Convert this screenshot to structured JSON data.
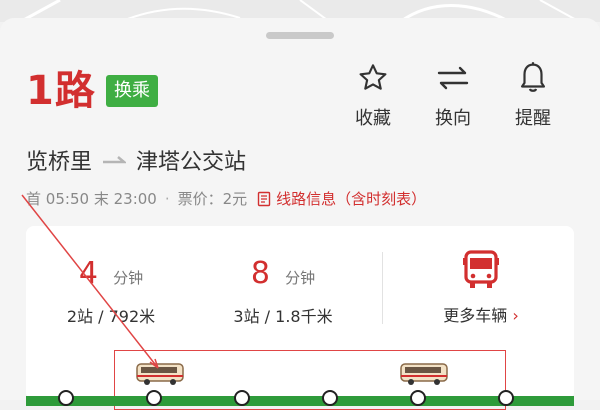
{
  "route": {
    "name": "1路",
    "transfer_label": "换乘"
  },
  "actions": [
    {
      "label": "收藏",
      "icon": "star-icon"
    },
    {
      "label": "换向",
      "icon": "swap-icon"
    },
    {
      "label": "提醒",
      "icon": "bell-icon"
    }
  ],
  "direction": {
    "from": "览桥里",
    "to": "津塔公交站"
  },
  "service": {
    "first_label": "首",
    "first_time": "05:50",
    "last_label": "末",
    "last_time": "23:00",
    "fare": "票价：2元",
    "route_info_link": "线路信息（含时刻表）"
  },
  "arrivals": [
    {
      "minutes": "4",
      "unit": "分钟",
      "detail": "2站 / 792米"
    },
    {
      "minutes": "8",
      "unit": "分钟",
      "detail": "3站 / 1.8千米"
    }
  ],
  "more_vehicles_label": "更多车辆",
  "colors": {
    "brand_red": "#d22f2f",
    "transfer_green": "#3fae43",
    "line_green": "#2e9b3a"
  }
}
